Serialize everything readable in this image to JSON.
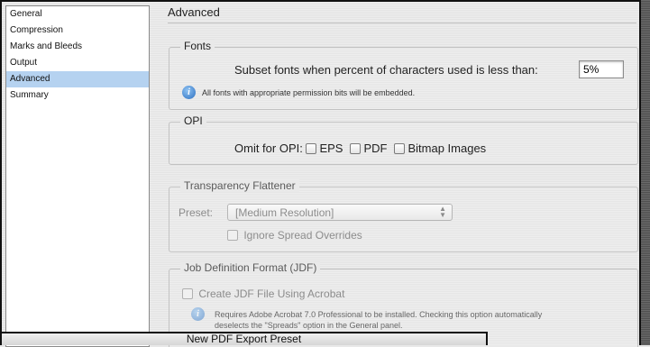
{
  "sidebar": {
    "items": [
      {
        "label": "General"
      },
      {
        "label": "Compression"
      },
      {
        "label": "Marks and Bleeds"
      },
      {
        "label": "Output"
      },
      {
        "label": "Advanced"
      },
      {
        "label": "Summary"
      }
    ],
    "selected": "Advanced"
  },
  "panel": {
    "title": "Advanced"
  },
  "fonts": {
    "legend": "Fonts",
    "subset_label": "Subset fonts when percent of characters used is less than:",
    "subset_value": "5%",
    "note": "All fonts with appropriate permission bits will be embedded."
  },
  "opi": {
    "legend": "OPI",
    "omit_label": "Omit for OPI:",
    "options": [
      "EPS",
      "PDF",
      "Bitmap Images"
    ]
  },
  "transparency": {
    "legend": "Transparency Flattener",
    "preset_label": "Preset:",
    "preset_value": "[Medium Resolution]",
    "ignore_label": "Ignore Spread Overrides"
  },
  "jdf": {
    "legend": "Job Definition Format (JDF)",
    "create_label": "Create JDF File Using Acrobat",
    "note_line1": "Requires Adobe Acrobat 7.0 Professional to be installed. Checking this option automatically",
    "note_line2": "deselects the \"Spreads\" option in the General panel."
  },
  "dialog": {
    "title": "New PDF Export Preset"
  }
}
